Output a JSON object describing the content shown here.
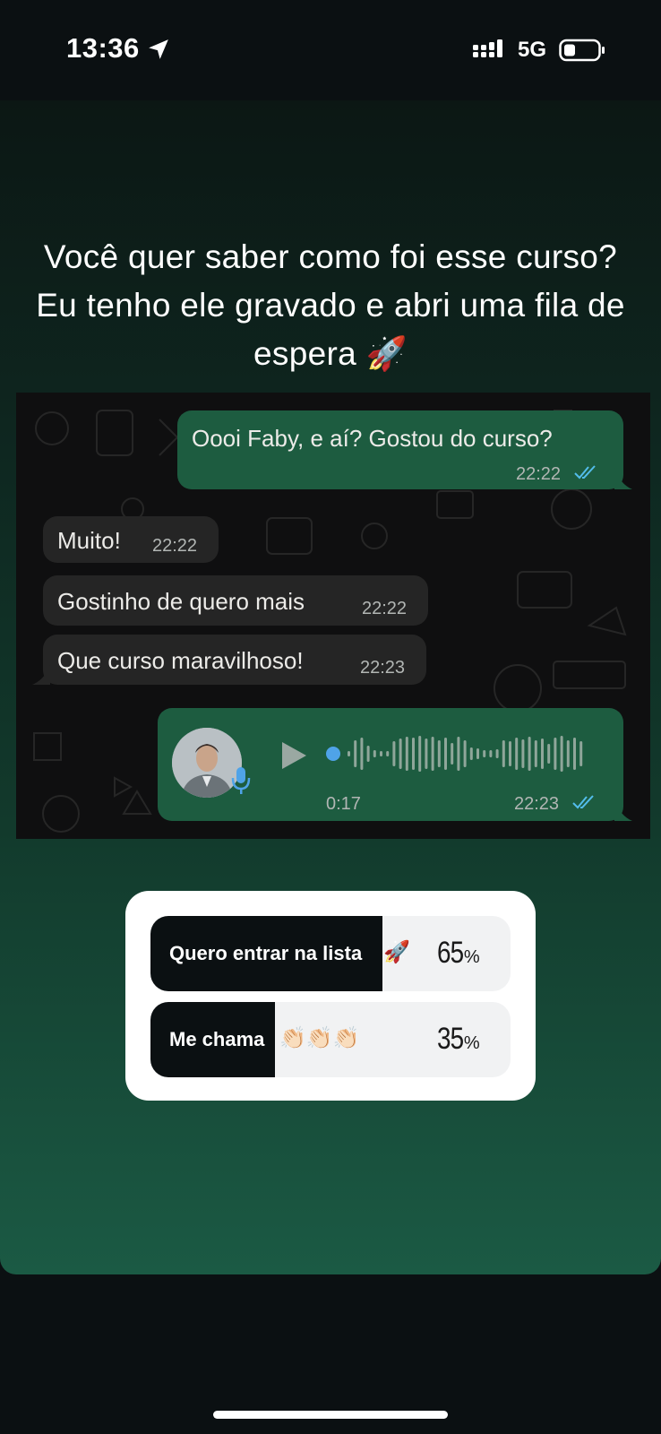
{
  "status_bar": {
    "time": "13:36",
    "network": "5G"
  },
  "story": {
    "caption": "Você quer saber como foi esse curso? Eu tenho ele gravado e abri uma fila de espera 🚀"
  },
  "chat": {
    "messages": [
      {
        "direction": "outgoing",
        "text": "Oooi Faby, e aí? Gostou do curso?",
        "time": "22:22"
      },
      {
        "direction": "incoming",
        "text": "Muito!",
        "time": "22:22"
      },
      {
        "direction": "incoming",
        "text": "Gostinho de quero mais",
        "time": "22:22"
      },
      {
        "direction": "incoming",
        "text": "Que curso maravilhoso!",
        "time": "22:23"
      }
    ],
    "voice_note": {
      "duration": "0:17",
      "time": "22:23",
      "progress": 0.0
    }
  },
  "poll": {
    "options": [
      {
        "label": "Quero entrar na lista",
        "emoji": "🚀",
        "percent": "65",
        "fraction": 0.65
      },
      {
        "label": "Me chama",
        "emoji": "👏🏻👏🏻👏🏻",
        "percent": "35",
        "fraction": 0.35
      }
    ],
    "percent_symbol": "%"
  },
  "colors": {
    "outgoing_bubble": "#1d5c40",
    "incoming_bubble": "#252525",
    "read_ticks": "#53bdeb",
    "voice_dot": "#4fa3e8"
  },
  "icons": [
    "location-arrow-icon",
    "signal-icon",
    "battery-icon",
    "double-check-icon",
    "play-icon",
    "mic-icon"
  ]
}
